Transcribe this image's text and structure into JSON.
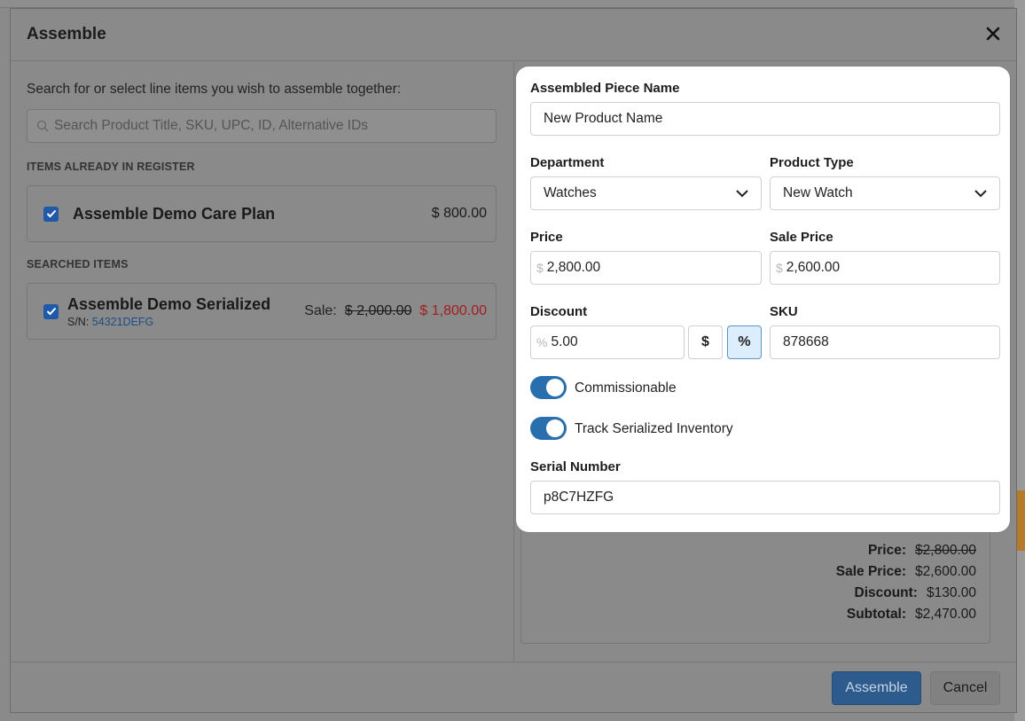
{
  "modal": {
    "title": "Assemble",
    "close_icon": "close-icon"
  },
  "left": {
    "instructions": "Search for or select line items you wish to assemble together:",
    "search_placeholder": "Search Product Title, SKU, UPC, ID, Alternative IDs",
    "register_section": "ITEMS ALREADY IN REGISTER",
    "register_items": [
      {
        "name": "Assemble Demo Care Plan",
        "price": "$ 800.00",
        "checked": true
      }
    ],
    "searched_section": "SEARCHED ITEMS",
    "searched_items": [
      {
        "name": "Assemble Demo Serialized",
        "sn_label": "S/N:",
        "sn_value": "54321DEFG",
        "sale_label": "Sale:",
        "original_price": "$ 2,000.00",
        "sale_price": "$ 1,800.00",
        "checked": true
      }
    ]
  },
  "form": {
    "piece_name_label": "Assembled Piece Name",
    "piece_name_value": "New Product Name",
    "department_label": "Department",
    "department_value": "Watches",
    "product_type_label": "Product Type",
    "product_type_value": "New Watch",
    "price_label": "Price",
    "price_prefix": "$",
    "price_value": "2,800.00",
    "sale_price_label": "Sale Price",
    "sale_price_prefix": "$",
    "sale_price_value": "2,600.00",
    "discount_label": "Discount",
    "discount_prefix": "%",
    "discount_value": "5.00",
    "discount_dollar_btn": "$",
    "discount_percent_btn": "%",
    "sku_label": "SKU",
    "sku_value": "878668",
    "commissionable_label": "Commissionable",
    "commissionable_on": true,
    "track_serial_label": "Track Serialized Inventory",
    "track_serial_on": true,
    "serial_label": "Serial Number",
    "serial_value": "p8C7HZFG"
  },
  "summary": {
    "price_label": "Price:",
    "price_value": "$2,800.00",
    "sale_price_label": "Sale Price:",
    "sale_price_value": "$2,600.00",
    "discount_label": "Discount:",
    "discount_value": "$130.00",
    "subtotal_label": "Subtotal:",
    "subtotal_value": "$2,470.00"
  },
  "footer": {
    "assemble_label": "Assemble",
    "cancel_label": "Cancel"
  },
  "colors": {
    "accent": "#2a6fad",
    "sale_red": "#a31e1e",
    "active_segment": "#dceefb"
  }
}
